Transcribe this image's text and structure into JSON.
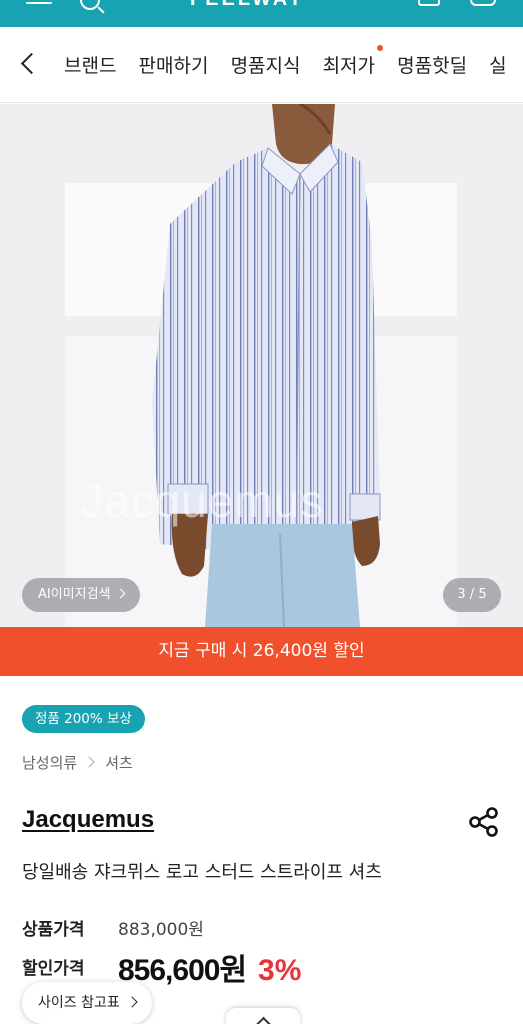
{
  "header": {
    "logo_text": "FEELWAY",
    "background_color": "#17a3b2",
    "icons": [
      "menu-icon",
      "search-icon",
      "shopping-bag-icon",
      "notification-bell-icon"
    ]
  },
  "category_nav": {
    "back_icon": "chevron-left-icon",
    "tabs": [
      {
        "label": "브랜드"
      },
      {
        "label": "판매하기"
      },
      {
        "label": "명품지식"
      },
      {
        "label": "최저가",
        "new_dot": true
      },
      {
        "label": "명품핫딜"
      },
      {
        "label": "실"
      }
    ]
  },
  "gallery": {
    "ai_search_label": "AI이미지검색",
    "counter": "3 / 5",
    "watermark": "Jacquemus"
  },
  "promo": {
    "text": "지금 구매 시 26,400원 할인",
    "color": "#f0502c"
  },
  "product": {
    "badge": "정품 200% 보상",
    "breadcrumb": [
      "남성의류",
      "셔츠"
    ],
    "brand": "Jacquemus",
    "name": "당일배송 쟈크뮈스 로고 스터드 스트라이프 셔츠",
    "price_label": "상품가격",
    "price": "883,000원",
    "discount_label": "할인가격",
    "discount_price": "856,600원",
    "discount_rate": "3%",
    "discount_color": "#e8333a"
  },
  "floating": {
    "size_chart_label": "사이즈 참고표",
    "scroll_top_icon": "chevron-up-icon"
  }
}
